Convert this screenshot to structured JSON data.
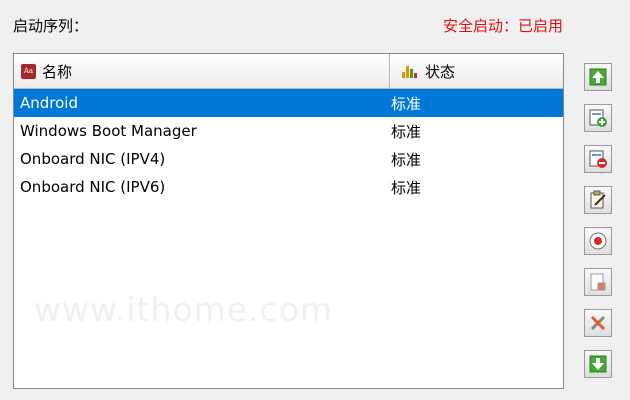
{
  "header": {
    "title": "启动序列：",
    "secure_boot": "安全启动：已启用"
  },
  "table": {
    "columns": [
      "名称",
      "状态"
    ],
    "column_icons": [
      "name-column-icon",
      "status-column-icon"
    ],
    "rows": [
      {
        "name": "Android",
        "status": "标准",
        "selected": true
      },
      {
        "name": "Windows Boot Manager",
        "status": "标准",
        "selected": false
      },
      {
        "name": "Onboard NIC (IPV4)",
        "status": "标准",
        "selected": false
      },
      {
        "name": "Onboard NIC (IPV6)",
        "status": "标准",
        "selected": false
      }
    ]
  },
  "toolbar": {
    "buttons": [
      "move-up-icon",
      "add-entry-icon",
      "remove-entry-icon",
      "edit-entry-icon",
      "set-default-icon",
      "open-file-icon",
      "tools-icon",
      "move-down-icon"
    ]
  },
  "watermark": "www.ithome.com",
  "colors": {
    "selection": "#0078d7",
    "secure_text": "#e01010"
  }
}
